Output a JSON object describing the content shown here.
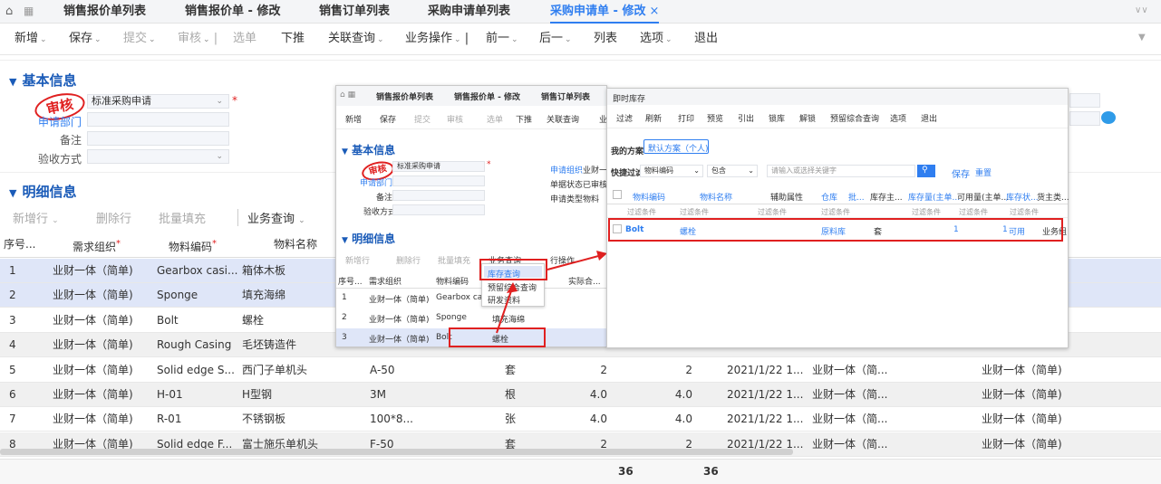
{
  "colors": {
    "accent": "#2f7ef0",
    "section": "#1a5bb8",
    "stamp": "#e02020",
    "highlight": "#e02020"
  },
  "tabs": {
    "home_icon": "home-icon",
    "grid_icon": "grid-icon",
    "items": [
      "销售报价单列表",
      "销售报价单 - 修改",
      "销售订单列表",
      "采购申请单列表",
      "采购申请单 - 修改"
    ],
    "close": "×"
  },
  "toolbar": {
    "items": [
      "新增",
      "保存",
      "提交",
      "审核",
      "选单",
      "下推",
      "关联查询",
      "业务操作",
      "前一",
      "后一",
      "列表",
      "选项",
      "退出"
    ]
  },
  "basic": {
    "title": "基本信息",
    "stamp": "审核",
    "doc_type_value": "标准采购申请",
    "required": "*",
    "label_dept": "申请部门",
    "label_remark": "备注",
    "label_accept": "验收方式"
  },
  "detail": {
    "title": "明细信息",
    "buttons": [
      "新增行",
      "删除行",
      "批量填充",
      "业务查询"
    ],
    "headers": [
      "序号...",
      "需求组织",
      "物料编码",
      "物料名称"
    ],
    "rows": [
      [
        "1",
        "业财一体（简单)",
        "Gearbox casi...",
        "箱体木板",
        "",
        "",
        "",
        "",
        "",
        "",
        ""
      ],
      [
        "2",
        "业财一体（简单)",
        "Sponge",
        "填充海绵",
        "",
        "",
        "",
        "",
        "",
        "",
        ""
      ],
      [
        "3",
        "业财一体（简单)",
        "Bolt",
        "螺栓",
        "",
        "",
        "",
        "",
        "",
        "",
        ""
      ],
      [
        "4",
        "业财一体（简单)",
        "Rough Casing",
        "毛坯铸造件",
        "",
        "",
        "",
        "",
        "",
        "",
        ""
      ],
      [
        "5",
        "业财一体（简单)",
        "Solid edge S...",
        "西门子单机头",
        "A-50",
        "套",
        "2",
        "2",
        "2021/1/22 1...",
        "业财一体（简...",
        "业财一体（简单)"
      ],
      [
        "6",
        "业财一体（简单)",
        "H-01",
        "H型钢",
        "3M",
        "根",
        "4.0",
        "4.0",
        "2021/1/22 1...",
        "业财一体（简...",
        "业财一体（简单)"
      ],
      [
        "7",
        "业财一体（简单)",
        "R-01",
        "不锈钢板",
        "100*8...",
        "张",
        "4.0",
        "4.0",
        "2021/1/22 1...",
        "业财一体（简...",
        "业财一体（简单)"
      ],
      [
        "8",
        "业财一体（简单)",
        "Solid edge F...",
        "富士施乐单机头",
        "F-50",
        "套",
        "2",
        "2",
        "2021/1/22 1...",
        "业财一体（简...",
        "业财一体（简单)"
      ]
    ],
    "totals": [
      "36",
      "36"
    ]
  },
  "mini": {
    "tabs": [
      "销售报价单列表",
      "销售报价单 - 修改",
      "销售订单列表"
    ],
    "toolbar": [
      "新增",
      "保存",
      "提交",
      "审核",
      "选单",
      "下推",
      "关联查询",
      "业"
    ],
    "basic_title": "基本信息",
    "stamp": "审核",
    "doc_type": "标准采购申请",
    "label_dept": "申请部门",
    "label_remark": "备注",
    "label_accept": "验收方式",
    "right_labels": [
      "申请组织",
      "单据状态",
      "申请类型"
    ],
    "right_values": [
      "业财一体",
      "已审核",
      "物料"
    ],
    "detail_title": "明细信息",
    "buttons": [
      "新增行",
      "删除行",
      "批量填充",
      "业务查询",
      "行操作"
    ],
    "headers": [
      "序号...",
      "需求组织",
      "物料编码",
      "实际合..."
    ],
    "menu": [
      "库存查询",
      "预留综合查询",
      "研发资料"
    ],
    "rows": [
      [
        "1",
        "业财一体（简单)",
        "Gearbox casi..."
      ],
      [
        "2",
        "业财一体（简单)",
        "Sponge",
        "填充海绵"
      ],
      [
        "3",
        "业财一体（简单)",
        "Bolt",
        "螺栓"
      ]
    ]
  },
  "inventory": {
    "title": "即时库存",
    "toolbar": [
      "过滤",
      "刷新",
      "打印",
      "预览",
      "引出",
      "锁库",
      "解锁",
      "预留综合查询",
      "选项",
      "退出"
    ],
    "scheme_label": "我的方案",
    "scheme_btn": "默认方案（个人)",
    "quick_label": "快捷过滤",
    "quick_field": "物料编码",
    "quick_op": "包含",
    "quick_placeholder": "请输入或选择关键字",
    "save": "保存",
    "reset": "重置",
    "headers": [
      "物料编码",
      "物料名称",
      "辅助属性",
      "仓库",
      "批...",
      "库存主...",
      "库存量(主单...",
      "可用量(主单...",
      "库存状...",
      "货主类..."
    ],
    "filter": "过滤条件",
    "row": {
      "code": "Bolt",
      "name": "螺栓",
      "warehouse": "原料库",
      "unit": "套",
      "stock": "1",
      "available": "1",
      "status": "可用",
      "owner": "业务组"
    }
  }
}
